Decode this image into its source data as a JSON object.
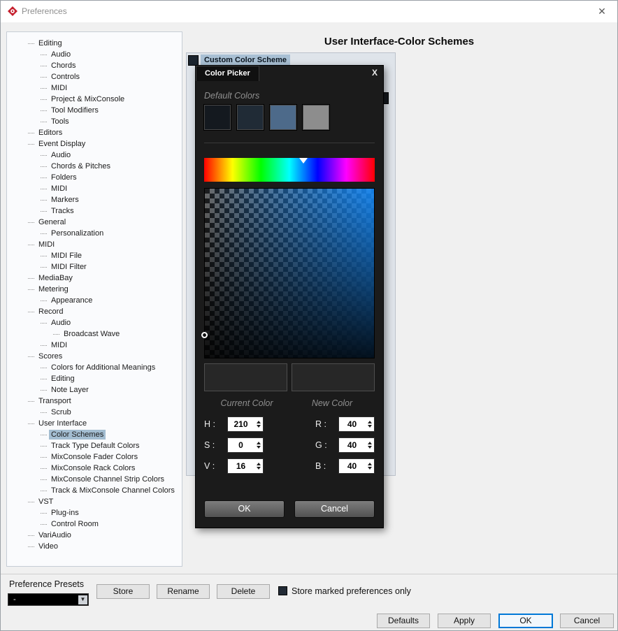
{
  "window": {
    "title": "Preferences",
    "close_glyph": "✕"
  },
  "sidebar": {
    "items": [
      {
        "label": "Editing",
        "level": 1
      },
      {
        "label": "Audio",
        "level": 2
      },
      {
        "label": "Chords",
        "level": 2
      },
      {
        "label": "Controls",
        "level": 2
      },
      {
        "label": "MIDI",
        "level": 2
      },
      {
        "label": "Project & MixConsole",
        "level": 2
      },
      {
        "label": "Tool Modifiers",
        "level": 2
      },
      {
        "label": "Tools",
        "level": 2
      },
      {
        "label": "Editors",
        "level": 1
      },
      {
        "label": "Event Display",
        "level": 1
      },
      {
        "label": "Audio",
        "level": 2
      },
      {
        "label": "Chords & Pitches",
        "level": 2
      },
      {
        "label": "Folders",
        "level": 2
      },
      {
        "label": "MIDI",
        "level": 2
      },
      {
        "label": "Markers",
        "level": 2
      },
      {
        "label": "Tracks",
        "level": 2
      },
      {
        "label": "General",
        "level": 1
      },
      {
        "label": "Personalization",
        "level": 2
      },
      {
        "label": "MIDI",
        "level": 1
      },
      {
        "label": "MIDI File",
        "level": 2
      },
      {
        "label": "MIDI Filter",
        "level": 2
      },
      {
        "label": "MediaBay",
        "level": 1
      },
      {
        "label": "Metering",
        "level": 1
      },
      {
        "label": "Appearance",
        "level": 2
      },
      {
        "label": "Record",
        "level": 1
      },
      {
        "label": "Audio",
        "level": 2
      },
      {
        "label": "Broadcast Wave",
        "level": 3
      },
      {
        "label": "MIDI",
        "level": 2
      },
      {
        "label": "Scores",
        "level": 1
      },
      {
        "label": "Colors for Additional Meanings",
        "level": 2
      },
      {
        "label": "Editing",
        "level": 2
      },
      {
        "label": "Note Layer",
        "level": 2
      },
      {
        "label": "Transport",
        "level": 1
      },
      {
        "label": "Scrub",
        "level": 2
      },
      {
        "label": "User Interface",
        "level": 1
      },
      {
        "label": "Color Schemes",
        "level": 2,
        "selected": true
      },
      {
        "label": "Track Type Default Colors",
        "level": 2
      },
      {
        "label": "MixConsole Fader Colors",
        "level": 2
      },
      {
        "label": "MixConsole Rack Colors",
        "level": 2
      },
      {
        "label": "MixConsole Channel Strip Colors",
        "level": 2
      },
      {
        "label": "Track & MixConsole Channel Colors",
        "level": 2
      },
      {
        "label": "VST",
        "level": 1
      },
      {
        "label": "Plug-ins",
        "level": 2
      },
      {
        "label": "Control Room",
        "level": 2
      },
      {
        "label": "VariAudio",
        "level": 1
      },
      {
        "label": "Video",
        "level": 1
      }
    ]
  },
  "content": {
    "title": "User Interface-Color Schemes",
    "scheme_row": {
      "label": "Custom Color Scheme",
      "swatch_color": "#1b242e"
    }
  },
  "color_picker": {
    "title": "Color Picker",
    "close_glyph": "X",
    "default_colors_label": "Default Colors",
    "default_colors": [
      "#14191f",
      "#202b36",
      "#4d6a8a",
      "#8d8d8d"
    ],
    "hue_marker_percent": 58.3,
    "current_color": "#272727",
    "new_color": "#272727",
    "current_color_label": "Current Color",
    "new_color_label": "New Color",
    "hsv": {
      "h_label": "H :",
      "h": "210",
      "s_label": "S :",
      "s": "0",
      "v_label": "V :",
      "v": "16"
    },
    "rgb": {
      "r_label": "R :",
      "r": "40",
      "g_label": "G :",
      "g": "40",
      "b_label": "B :",
      "b": "40"
    },
    "ok_label": "OK",
    "cancel_label": "Cancel"
  },
  "preset_bar": {
    "label": "Preference Presets",
    "dropdown_value": "-",
    "store_label": "Store",
    "rename_label": "Rename",
    "delete_label": "Delete",
    "checkbox_label": "Store marked preferences only"
  },
  "footer": {
    "defaults_label": "Defaults",
    "apply_label": "Apply",
    "ok_label": "OK",
    "cancel_label": "Cancel"
  }
}
